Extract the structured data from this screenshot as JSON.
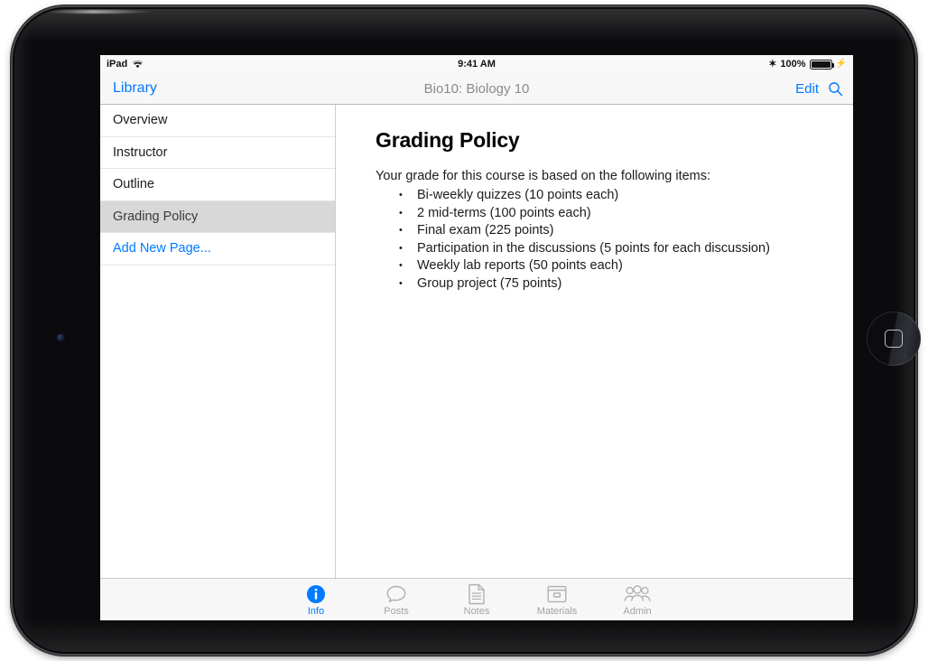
{
  "status_bar": {
    "device_label": "iPad",
    "wifi_icon": "wifi-icon",
    "time": "9:41 AM",
    "bluetooth_icon": "bluetooth-icon",
    "battery_percent": "100%",
    "battery_icon": "battery-full-icon",
    "charging_icon": "lightning-bolt-icon"
  },
  "nav_bar": {
    "back_label": "Library",
    "title": "Bio10: Biology 10",
    "edit_label": "Edit",
    "search_icon": "search-icon"
  },
  "sidebar": {
    "items": [
      {
        "label": "Overview",
        "selected": false,
        "action": false
      },
      {
        "label": "Instructor",
        "selected": false,
        "action": false
      },
      {
        "label": "Outline",
        "selected": false,
        "action": false
      },
      {
        "label": "Grading Policy",
        "selected": true,
        "action": false
      },
      {
        "label": "Add New Page...",
        "selected": false,
        "action": true
      }
    ]
  },
  "main": {
    "title": "Grading Policy",
    "intro": "Your grade for this course is based on the following items:",
    "bullets": [
      "Bi-weekly quizzes (10 points each)",
      "2 mid-terms (100 points each)",
      "Final exam (225 points)",
      "Participation in the discussions (5 points for each discussion)",
      "Weekly lab reports (50 points each)",
      "Group project (75 points)"
    ]
  },
  "tab_bar": {
    "tabs": [
      {
        "label": "Info",
        "icon": "info-circle-icon",
        "active": true
      },
      {
        "label": "Posts",
        "icon": "speech-bubble-icon",
        "active": false
      },
      {
        "label": "Notes",
        "icon": "document-page-icon",
        "active": false
      },
      {
        "label": "Materials",
        "icon": "archive-box-icon",
        "active": false
      },
      {
        "label": "Admin",
        "icon": "people-group-icon",
        "active": false
      }
    ]
  },
  "colors": {
    "accent": "#007aff",
    "selected_row": "#d8d8d8",
    "chrome": "#f7f7f7",
    "text": "#1c1c1e",
    "muted": "#a3a3a6"
  }
}
